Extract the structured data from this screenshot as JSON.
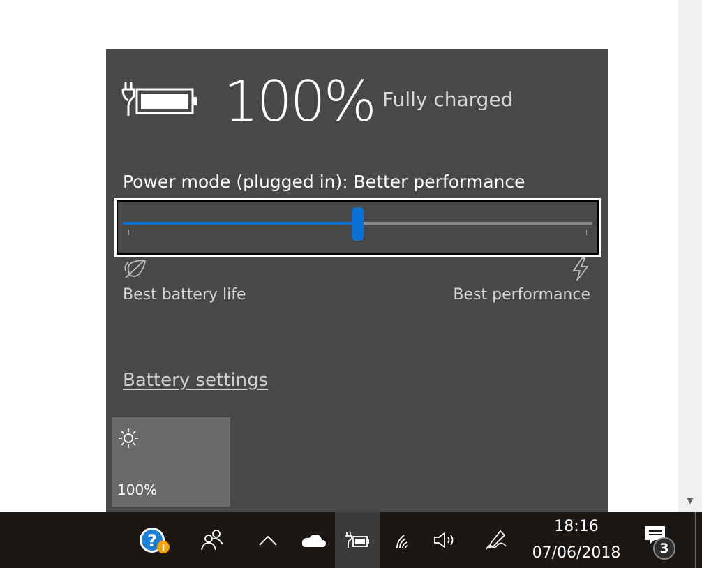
{
  "flyout": {
    "percent": "100%",
    "status": "Fully charged",
    "power_mode_label": "Power mode (plugged in): Better performance",
    "slider": {
      "value_fraction": 0.5,
      "left_label": "Best battery life",
      "right_label": "Best performance"
    },
    "settings_link": "Battery settings",
    "brightness_tile": {
      "label": "100%",
      "icon": "sun-icon"
    }
  },
  "taskbar": {
    "time": "18:16",
    "date": "07/06/2018",
    "notification_count": "3",
    "icons": [
      "help-info-icon",
      "people-icon",
      "show-hidden-icons-icon",
      "onedrive-icon",
      "battery-icon",
      "wifi-icon",
      "volume-icon",
      "pen-workspace-icon",
      "action-center-icon"
    ]
  },
  "colors": {
    "flyout_bg": "#484848",
    "accent": "#0a72d6",
    "taskbar_bg": "#1a1715"
  }
}
